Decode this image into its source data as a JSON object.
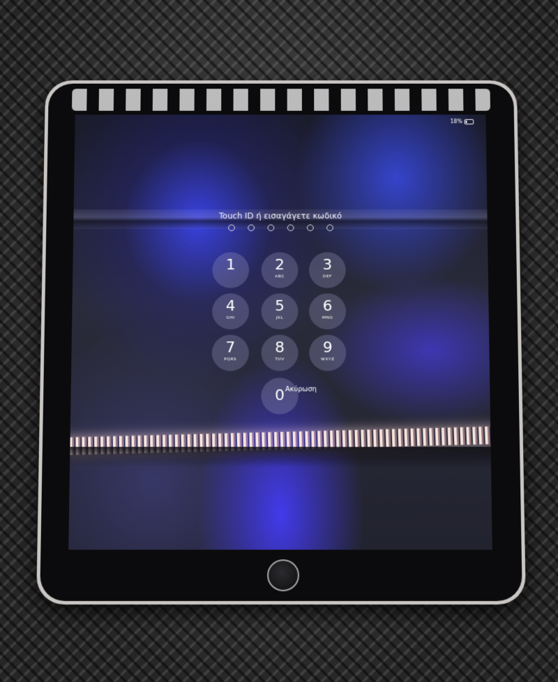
{
  "status": {
    "battery": "18%"
  },
  "lock_screen": {
    "prompt": "Touch ID ή εισαγάγετε κωδικό",
    "passcode_dots": 6,
    "keys": [
      {
        "num": "1",
        "sub": ""
      },
      {
        "num": "2",
        "sub": "ABC"
      },
      {
        "num": "3",
        "sub": "DEF"
      },
      {
        "num": "4",
        "sub": "GHI"
      },
      {
        "num": "5",
        "sub": "JKL"
      },
      {
        "num": "6",
        "sub": "MNO"
      },
      {
        "num": "7",
        "sub": "PQRS"
      },
      {
        "num": "8",
        "sub": "TUV"
      },
      {
        "num": "9",
        "sub": "WXYZ"
      },
      {
        "num": "0",
        "sub": ""
      }
    ],
    "cancel_label": "Ακύρωση"
  },
  "colors": {
    "frame": "#c9c6c4",
    "bezel": "#0b0b0d",
    "wallpaper_accent": "#3c46ff"
  }
}
